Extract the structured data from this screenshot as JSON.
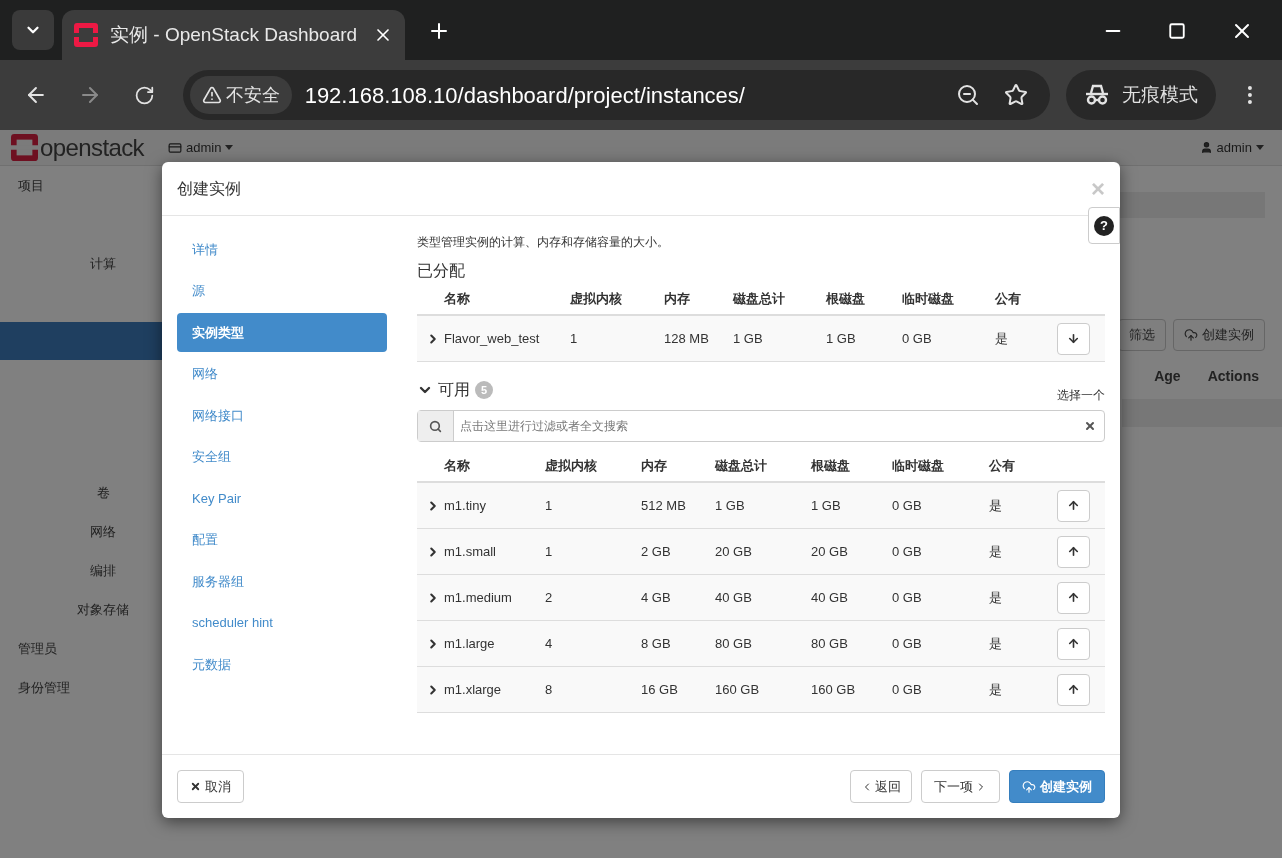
{
  "browser": {
    "tabs": [
      {
        "title": "实例 - OpenStack Dashboard",
        "selected": true
      }
    ],
    "security": "不安全",
    "url": "192.168.108.10/dashboard/project/instances/",
    "incognito": "无痕模式"
  },
  "page": {
    "logo": "openstack",
    "project": "admin",
    "user": "admin",
    "sidebar": [
      {
        "label": "项目",
        "kind": "section"
      },
      {
        "label": "计算",
        "kind": "sub"
      },
      {
        "label": "卷",
        "kind": "sub"
      },
      {
        "label": "网络",
        "kind": "sub"
      },
      {
        "label": "编排",
        "kind": "sub"
      },
      {
        "label": "对象存储",
        "kind": "sub"
      },
      {
        "label": "管理员",
        "kind": "section"
      },
      {
        "label": "身份管理",
        "kind": "section"
      }
    ],
    "buttons": [
      "筛选",
      "创建实例"
    ],
    "columns": [
      "Age",
      "Actions"
    ]
  },
  "modal": {
    "title": "创建实例",
    "close": "×",
    "help": "?",
    "steps": [
      {
        "label": "详情",
        "selected": false
      },
      {
        "label": "源",
        "selected": false
      },
      {
        "label": "实例类型",
        "selected": true
      },
      {
        "label": "网络",
        "selected": false
      },
      {
        "label": "网络接口",
        "selected": false
      },
      {
        "label": "安全组",
        "selected": false
      },
      {
        "label": "Key Pair",
        "selected": false
      },
      {
        "label": "配置",
        "selected": false
      },
      {
        "label": "服务器组",
        "selected": false
      },
      {
        "label": "scheduler hint",
        "selected": false
      },
      {
        "label": "元数据",
        "selected": false
      }
    ],
    "description": "类型管理实例的计算、内存和存储容量的大小。",
    "allocated": {
      "title": "已分配",
      "columns": [
        "名称",
        "虚拟内核",
        "内存",
        "磁盘总计",
        "根磁盘",
        "临时磁盘",
        "公有"
      ],
      "rows": [
        [
          "Flavor_web_test",
          "1",
          "128 MB",
          "1 GB",
          "1 GB",
          "0 GB",
          "是"
        ]
      ]
    },
    "available": {
      "title": "可用",
      "count": "5",
      "hint": "选择一个",
      "search_placeholder": "点击这里进行过滤或者全文搜索",
      "columns": [
        "名称",
        "虚拟内核",
        "内存",
        "磁盘总计",
        "根磁盘",
        "临时磁盘",
        "公有"
      ],
      "rows": [
        [
          "m1.tiny",
          "1",
          "512 MB",
          "1 GB",
          "1 GB",
          "0 GB",
          "是"
        ],
        [
          "m1.small",
          "1",
          "2 GB",
          "20 GB",
          "20 GB",
          "0 GB",
          "是"
        ],
        [
          "m1.medium",
          "2",
          "4 GB",
          "40 GB",
          "40 GB",
          "0 GB",
          "是"
        ],
        [
          "m1.large",
          "4",
          "8 GB",
          "80 GB",
          "80 GB",
          "0 GB",
          "是"
        ],
        [
          "m1.xlarge",
          "8",
          "16 GB",
          "160 GB",
          "160 GB",
          "0 GB",
          "是"
        ]
      ]
    },
    "footer": {
      "cancel": "取消",
      "back": "返回",
      "next": "下一项",
      "create": "创建实例"
    }
  }
}
